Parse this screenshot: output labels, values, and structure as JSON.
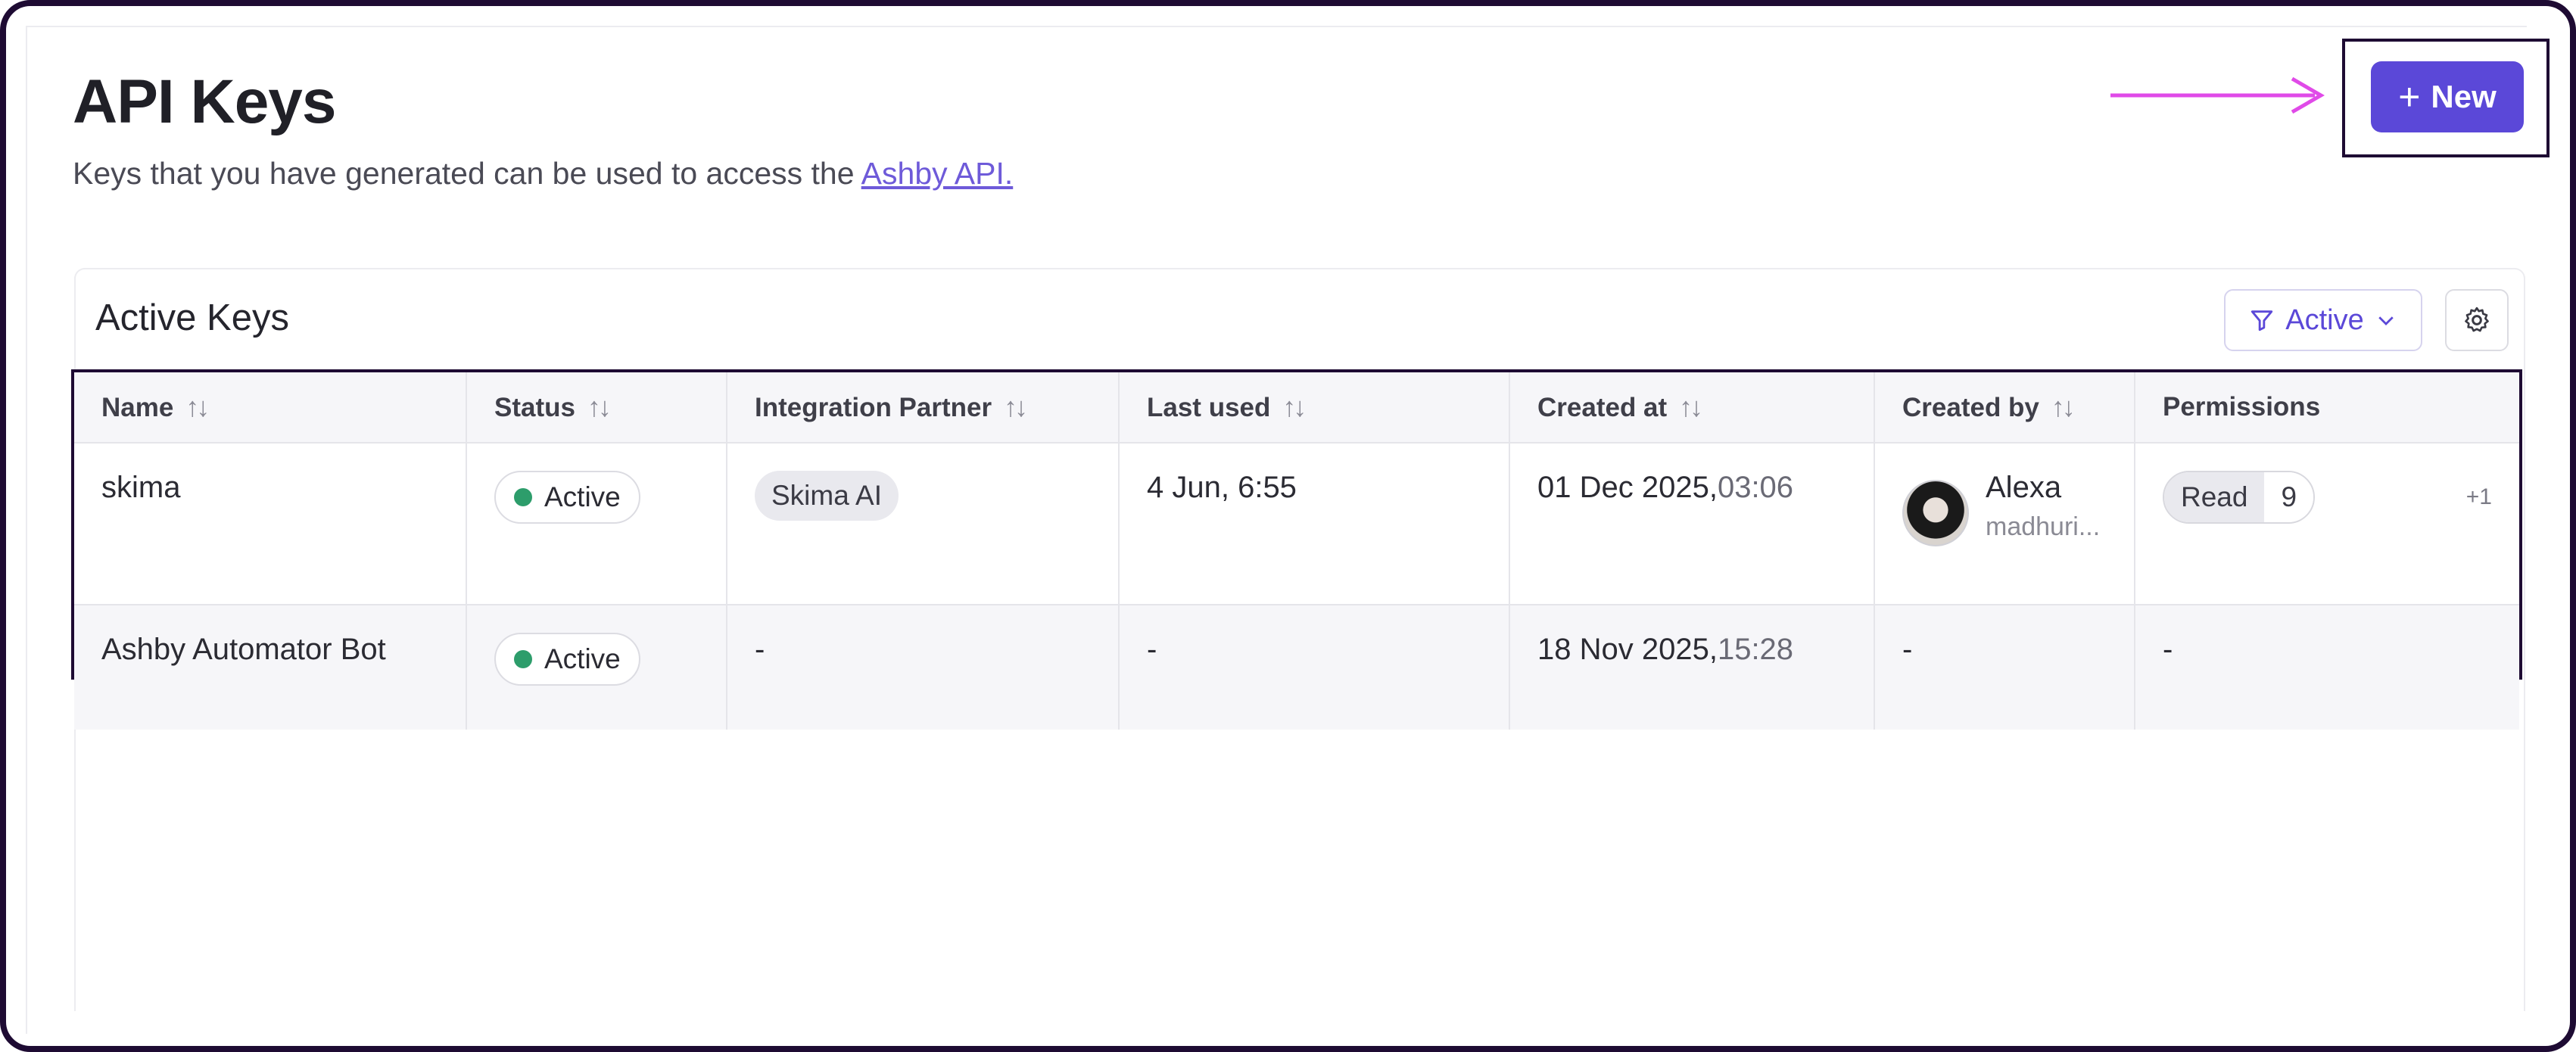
{
  "header": {
    "title": "API Keys",
    "subtitle": "Keys that you have generated can be used to access the",
    "subtitle_link": "Ashby API.",
    "new_button": "New"
  },
  "card": {
    "title": "Active Keys",
    "filter_label": "Active"
  },
  "table": {
    "columns": {
      "name": "Name",
      "status": "Status",
      "partner": "Integration Partner",
      "last_used": "Last used",
      "created_at": "Created at",
      "created_by": "Created by",
      "permissions": "Permissions"
    },
    "rows": [
      {
        "name": "skima",
        "status": "Active",
        "partner": "Skima AI",
        "last_used": "4 Jun, 6:55",
        "created_date": "01 Dec 2025,",
        "created_time": "03:06",
        "creator_name": "Alexa",
        "creator_sub": "madhuri...",
        "perm_label": "Read",
        "perm_count": "9",
        "perm_more": "+1"
      },
      {
        "name": "Ashby Automator Bot",
        "status": "Active",
        "partner": "-",
        "last_used": "-",
        "created_date": "18 Nov 2025,",
        "created_time": "15:28",
        "created_by": "-",
        "permissions": "-"
      }
    ]
  },
  "colors": {
    "accent": "#5b48d8",
    "annotation_arrow": "#e04ae8",
    "frame": "#1e0b33",
    "status_active": "#2d9d6b"
  },
  "icons": [
    "plus-icon",
    "filter-icon",
    "chevron-down-icon",
    "gear-icon",
    "sort-icon",
    "arrow-right-icon"
  ]
}
